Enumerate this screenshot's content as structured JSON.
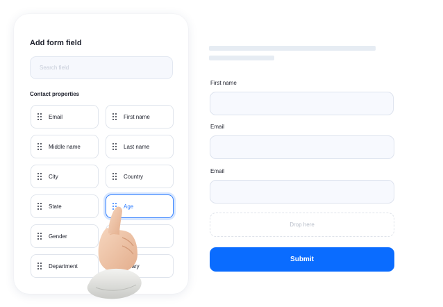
{
  "panel": {
    "title": "Add form field",
    "search_placeholder": "Search field",
    "section_label": "Contact properties",
    "fields": [
      {
        "label": "Email"
      },
      {
        "label": "First name"
      },
      {
        "label": "Middle name"
      },
      {
        "label": "Last name"
      },
      {
        "label": "City"
      },
      {
        "label": "Country"
      },
      {
        "label": "State"
      },
      {
        "label": "Age",
        "active": true
      },
      {
        "label": "Gender"
      },
      {
        "label": ""
      },
      {
        "label": "Department"
      },
      {
        "label": "Salary"
      }
    ]
  },
  "form": {
    "fields": [
      {
        "label": "First name"
      },
      {
        "label": "Email"
      },
      {
        "label": "Email"
      }
    ],
    "drop_placeholder": "Drop here",
    "submit_label": "Submit"
  },
  "colors": {
    "accent": "#0a6cff",
    "active_border": "#2e7dff",
    "field_bg": "#f7f9fe"
  },
  "icons": [
    "drag-handle-icon",
    "pointing-hand-icon"
  ]
}
